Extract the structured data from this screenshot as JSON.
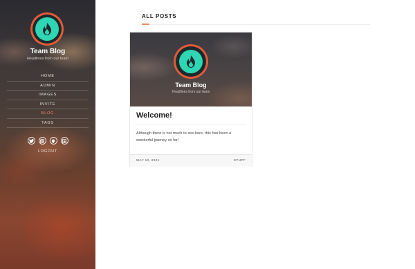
{
  "sidebar": {
    "title": "Team Blog",
    "subtitle": "Headlines from our team",
    "nav": [
      {
        "label": "HOME",
        "active": false
      },
      {
        "label": "ADMIN",
        "active": false
      },
      {
        "label": "IMAGES",
        "active": false
      },
      {
        "label": "INVITE",
        "active": false
      },
      {
        "label": "BLOG",
        "active": true
      },
      {
        "label": "TAGS",
        "active": false
      }
    ],
    "social": [
      "twitter-icon",
      "instagram-icon",
      "github-icon",
      "linkedin-icon"
    ],
    "logout": "LOGOUT"
  },
  "main": {
    "section_title": "ALL POSTS",
    "accent": "#f08a6a",
    "post": {
      "hero_title": "Team Blog",
      "hero_subtitle": "Headlines from our team",
      "title": "Welcome!",
      "excerpt": "Although there is not much to see here, this has been a wonderful journey so far!",
      "date": "MAY 10, 2021",
      "tag": "STUFF"
    }
  },
  "colors": {
    "logo_ring": "#e25a3a",
    "logo_core": "#2fd6b4",
    "active_nav": "#f0886a"
  }
}
